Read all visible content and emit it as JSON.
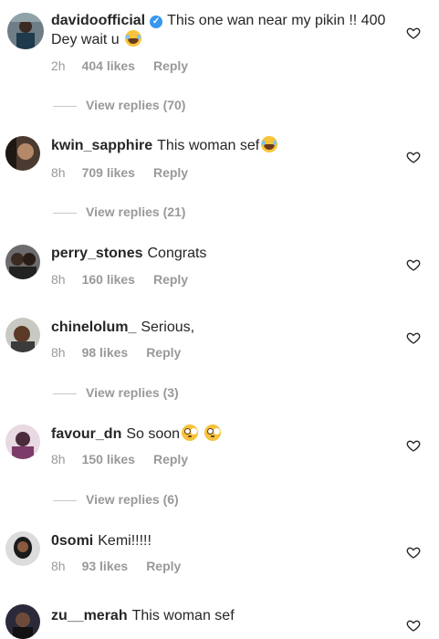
{
  "comments": [
    {
      "username": "davidoofficial",
      "verified": true,
      "text": "This one wan near my pikin !! 400 Dey wait u",
      "emoji": "laugh",
      "time": "2h",
      "likes": "404 likes",
      "reply": "Reply",
      "view_replies": "View replies (70)"
    },
    {
      "username": "kwin_sapphire",
      "verified": false,
      "text": "This woman sef",
      "emoji": "laugh",
      "time": "8h",
      "likes": "709 likes",
      "reply": "Reply",
      "view_replies": "View replies (21)"
    },
    {
      "username": "perry_stones",
      "verified": false,
      "text": "Congrats",
      "time": "8h",
      "likes": "160 likes",
      "reply": "Reply"
    },
    {
      "username": "chinelolum_",
      "verified": false,
      "text": "Serious,",
      "time": "8h",
      "likes": "98 likes",
      "reply": "Reply",
      "view_replies": "View replies (3)"
    },
    {
      "username": "favour_dn",
      "verified": false,
      "text": "So soon",
      "emoji": "flushed x2",
      "time": "8h",
      "likes": "150 likes",
      "reply": "Reply",
      "view_replies": "View replies (6)"
    },
    {
      "username": "0somi",
      "verified": false,
      "text": "Kemi!!!!!",
      "time": "8h",
      "likes": "93 likes",
      "reply": "Reply"
    },
    {
      "username": "zu__merah",
      "verified": false,
      "text": "This woman sef"
    }
  ],
  "colors": {
    "text": "#262626",
    "meta": "#999999",
    "verified": "#3897f0"
  },
  "icons": {
    "like": "heart-outline-icon",
    "verified": "verified-badge-icon"
  }
}
